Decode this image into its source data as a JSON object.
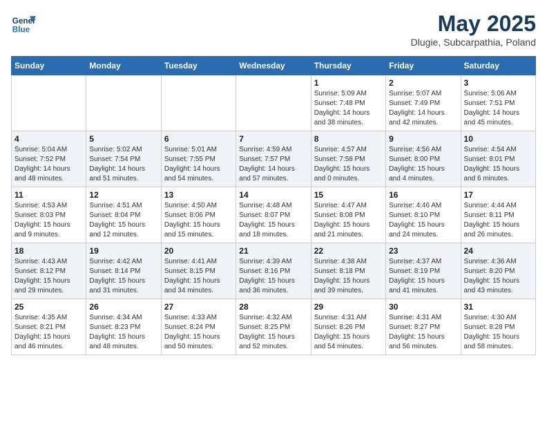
{
  "header": {
    "logo_line1": "General",
    "logo_line2": "Blue",
    "month_title": "May 2025",
    "location": "Dlugie, Subcarpathia, Poland"
  },
  "weekdays": [
    "Sunday",
    "Monday",
    "Tuesday",
    "Wednesday",
    "Thursday",
    "Friday",
    "Saturday"
  ],
  "weeks": [
    [
      {
        "day": "",
        "info": ""
      },
      {
        "day": "",
        "info": ""
      },
      {
        "day": "",
        "info": ""
      },
      {
        "day": "",
        "info": ""
      },
      {
        "day": "1",
        "info": "Sunrise: 5:09 AM\nSunset: 7:48 PM\nDaylight: 14 hours\nand 38 minutes."
      },
      {
        "day": "2",
        "info": "Sunrise: 5:07 AM\nSunset: 7:49 PM\nDaylight: 14 hours\nand 42 minutes."
      },
      {
        "day": "3",
        "info": "Sunrise: 5:06 AM\nSunset: 7:51 PM\nDaylight: 14 hours\nand 45 minutes."
      }
    ],
    [
      {
        "day": "4",
        "info": "Sunrise: 5:04 AM\nSunset: 7:52 PM\nDaylight: 14 hours\nand 48 minutes."
      },
      {
        "day": "5",
        "info": "Sunrise: 5:02 AM\nSunset: 7:54 PM\nDaylight: 14 hours\nand 51 minutes."
      },
      {
        "day": "6",
        "info": "Sunrise: 5:01 AM\nSunset: 7:55 PM\nDaylight: 14 hours\nand 54 minutes."
      },
      {
        "day": "7",
        "info": "Sunrise: 4:59 AM\nSunset: 7:57 PM\nDaylight: 14 hours\nand 57 minutes."
      },
      {
        "day": "8",
        "info": "Sunrise: 4:57 AM\nSunset: 7:58 PM\nDaylight: 15 hours\nand 0 minutes."
      },
      {
        "day": "9",
        "info": "Sunrise: 4:56 AM\nSunset: 8:00 PM\nDaylight: 15 hours\nand 4 minutes."
      },
      {
        "day": "10",
        "info": "Sunrise: 4:54 AM\nSunset: 8:01 PM\nDaylight: 15 hours\nand 6 minutes."
      }
    ],
    [
      {
        "day": "11",
        "info": "Sunrise: 4:53 AM\nSunset: 8:03 PM\nDaylight: 15 hours\nand 9 minutes."
      },
      {
        "day": "12",
        "info": "Sunrise: 4:51 AM\nSunset: 8:04 PM\nDaylight: 15 hours\nand 12 minutes."
      },
      {
        "day": "13",
        "info": "Sunrise: 4:50 AM\nSunset: 8:06 PM\nDaylight: 15 hours\nand 15 minutes."
      },
      {
        "day": "14",
        "info": "Sunrise: 4:48 AM\nSunset: 8:07 PM\nDaylight: 15 hours\nand 18 minutes."
      },
      {
        "day": "15",
        "info": "Sunrise: 4:47 AM\nSunset: 8:08 PM\nDaylight: 15 hours\nand 21 minutes."
      },
      {
        "day": "16",
        "info": "Sunrise: 4:46 AM\nSunset: 8:10 PM\nDaylight: 15 hours\nand 24 minutes."
      },
      {
        "day": "17",
        "info": "Sunrise: 4:44 AM\nSunset: 8:11 PM\nDaylight: 15 hours\nand 26 minutes."
      }
    ],
    [
      {
        "day": "18",
        "info": "Sunrise: 4:43 AM\nSunset: 8:12 PM\nDaylight: 15 hours\nand 29 minutes."
      },
      {
        "day": "19",
        "info": "Sunrise: 4:42 AM\nSunset: 8:14 PM\nDaylight: 15 hours\nand 31 minutes."
      },
      {
        "day": "20",
        "info": "Sunrise: 4:41 AM\nSunset: 8:15 PM\nDaylight: 15 hours\nand 34 minutes."
      },
      {
        "day": "21",
        "info": "Sunrise: 4:39 AM\nSunset: 8:16 PM\nDaylight: 15 hours\nand 36 minutes."
      },
      {
        "day": "22",
        "info": "Sunrise: 4:38 AM\nSunset: 8:18 PM\nDaylight: 15 hours\nand 39 minutes."
      },
      {
        "day": "23",
        "info": "Sunrise: 4:37 AM\nSunset: 8:19 PM\nDaylight: 15 hours\nand 41 minutes."
      },
      {
        "day": "24",
        "info": "Sunrise: 4:36 AM\nSunset: 8:20 PM\nDaylight: 15 hours\nand 43 minutes."
      }
    ],
    [
      {
        "day": "25",
        "info": "Sunrise: 4:35 AM\nSunset: 8:21 PM\nDaylight: 15 hours\nand 46 minutes."
      },
      {
        "day": "26",
        "info": "Sunrise: 4:34 AM\nSunset: 8:23 PM\nDaylight: 15 hours\nand 48 minutes."
      },
      {
        "day": "27",
        "info": "Sunrise: 4:33 AM\nSunset: 8:24 PM\nDaylight: 15 hours\nand 50 minutes."
      },
      {
        "day": "28",
        "info": "Sunrise: 4:32 AM\nSunset: 8:25 PM\nDaylight: 15 hours\nand 52 minutes."
      },
      {
        "day": "29",
        "info": "Sunrise: 4:31 AM\nSunset: 8:26 PM\nDaylight: 15 hours\nand 54 minutes."
      },
      {
        "day": "30",
        "info": "Sunrise: 4:31 AM\nSunset: 8:27 PM\nDaylight: 15 hours\nand 56 minutes."
      },
      {
        "day": "31",
        "info": "Sunrise: 4:30 AM\nSunset: 8:28 PM\nDaylight: 15 hours\nand 58 minutes."
      }
    ]
  ]
}
